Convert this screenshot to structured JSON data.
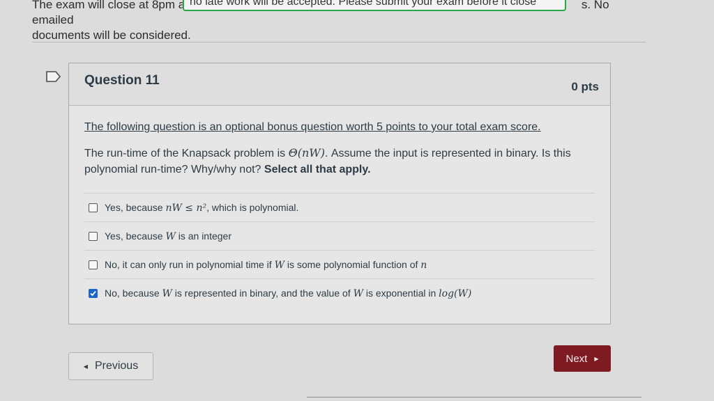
{
  "notice": {
    "line1_start": "The exam will close at 8pm and ",
    "line1_end": "s. No emailed",
    "line2": "documents will be considered.",
    "banner_text": "no late work will be accepted. Please submit your exam before it close"
  },
  "question": {
    "title": "Question 11",
    "points": "0 pts",
    "bonus_text": "The following question is an optional bonus question worth 5 points to your total exam score.",
    "prompt_part1": "The run-time of the Knapsack problem is ",
    "prompt_math": "Θ(nW)",
    "prompt_part2": ". Assume the input is represented in binary. Is this polynomial run-time? Why/why not? ",
    "prompt_bold": "Select all that apply.",
    "answers": [
      {
        "pre": "Yes, because ",
        "math": "nW ≤ n²",
        "post": ", which is polynomial.",
        "checked": false
      },
      {
        "pre": "Yes, because ",
        "math": "W",
        "post": " is an integer",
        "checked": false
      },
      {
        "pre": "No, it can only run in polynomial time if ",
        "math": "W",
        "post": " is some polynomial function of ",
        "math2": "n",
        "checked": false
      },
      {
        "pre": "No, because ",
        "math": "W",
        "post": " is represented in binary, and the value of ",
        "math2": "W",
        "post2": " is exponential in ",
        "math3": "log(W)",
        "checked": true
      }
    ]
  },
  "nav": {
    "previous_label": "Previous",
    "next_label": "Next"
  },
  "colors": {
    "next_button": "#7d1a22",
    "checkbox_checked": "#1b66c9",
    "banner_border": "#27a745"
  }
}
